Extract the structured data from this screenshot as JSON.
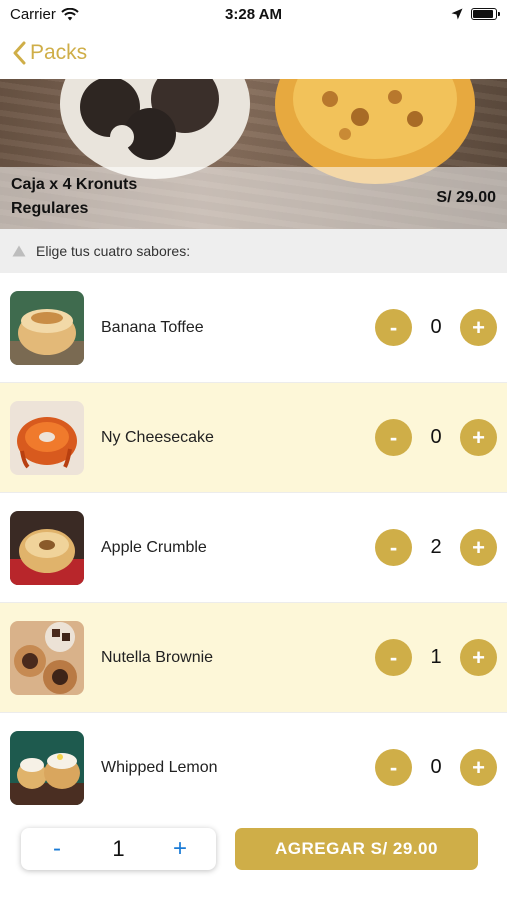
{
  "status_bar": {
    "carrier": "Carrier",
    "time": "3:28 AM"
  },
  "nav": {
    "back_label": "Packs",
    "accent_color": "#cfae48"
  },
  "hero": {
    "title": "Caja x 4 Kronuts\nRegulares",
    "price": "S/ 29.00"
  },
  "section": {
    "header": "Elige tus cuatro sabores:"
  },
  "flavors": [
    {
      "name": "Banana Toffee",
      "qty": "0",
      "minus": "-",
      "plus": "+"
    },
    {
      "name": "Ny Cheesecake",
      "qty": "0",
      "minus": "-",
      "plus": "+"
    },
    {
      "name": "Apple Crumble",
      "qty": "2",
      "minus": "-",
      "plus": "+"
    },
    {
      "name": "Nutella Brownie",
      "qty": "1",
      "minus": "-",
      "plus": "+"
    },
    {
      "name": "Whipped Lemon",
      "qty": "0",
      "minus": "-",
      "plus": "+"
    }
  ],
  "footer": {
    "minus": "-",
    "quantity": "1",
    "plus": "+",
    "add_label": "AGREGAR S/ 29.00"
  }
}
